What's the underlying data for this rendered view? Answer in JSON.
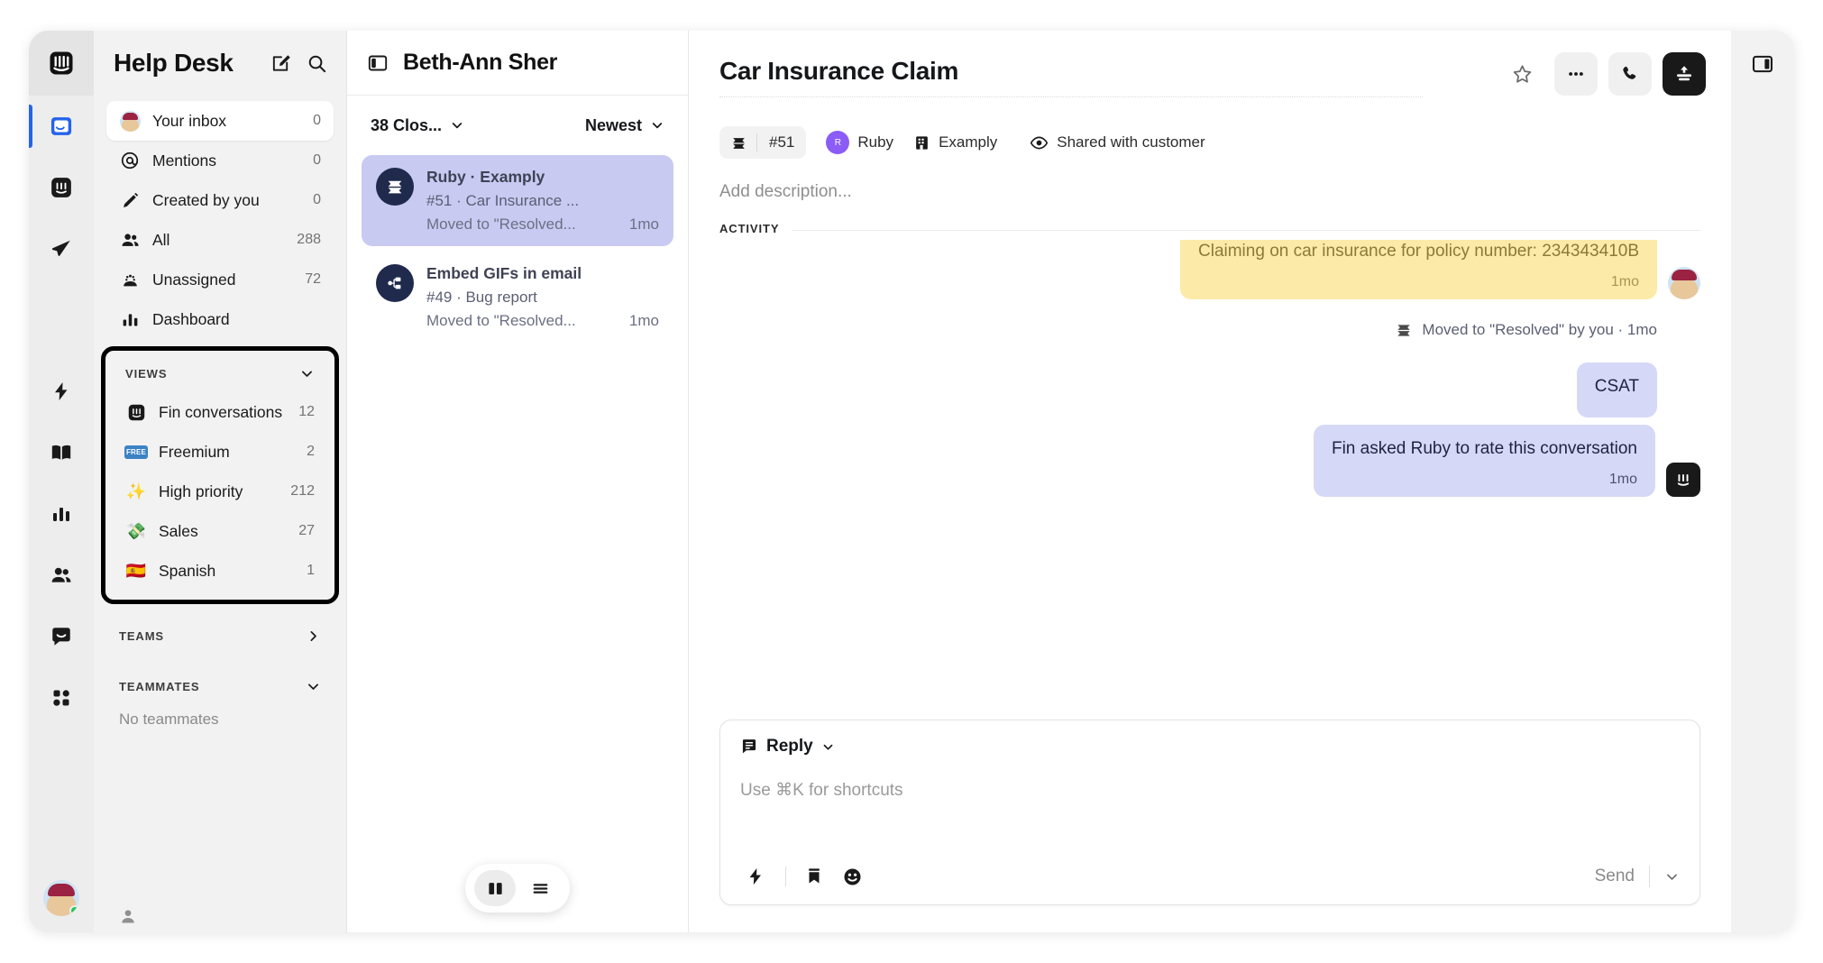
{
  "rail": {
    "logo_icon": "intercom-logo-icon",
    "items": [
      {
        "name": "inbox",
        "icon": "inbox-icon",
        "active": true
      },
      {
        "name": "fin",
        "icon": "fin-ai-icon",
        "active": false
      },
      {
        "name": "outbound",
        "icon": "paper-plane-icon",
        "active": false
      },
      {
        "name": "automation",
        "icon": "lightning-icon",
        "active": false
      },
      {
        "name": "knowledge",
        "icon": "book-icon",
        "active": false
      },
      {
        "name": "reports",
        "icon": "bar-chart-icon",
        "active": false
      },
      {
        "name": "contacts",
        "icon": "people-icon",
        "active": false
      },
      {
        "name": "messenger",
        "icon": "messenger-icon",
        "active": false
      },
      {
        "name": "apps",
        "icon": "apps-grid-icon",
        "active": false
      }
    ],
    "avatar_name": "user-avatar",
    "status": "online"
  },
  "sidebar": {
    "title": "Help Desk",
    "compose_icon": "compose-icon",
    "search_icon": "search-icon",
    "inbox_items": [
      {
        "label": "Your inbox",
        "count": "0",
        "icon": "user-avatar",
        "selected": true
      },
      {
        "label": "Mentions",
        "count": "0",
        "icon": "at-icon",
        "selected": false
      },
      {
        "label": "Created by you",
        "count": "0",
        "icon": "pencil-icon",
        "selected": false
      },
      {
        "label": "All",
        "count": "288",
        "icon": "people-icon",
        "selected": false
      },
      {
        "label": "Unassigned",
        "count": "72",
        "icon": "unassigned-icon",
        "selected": false
      },
      {
        "label": "Dashboard",
        "count": "",
        "icon": "bar-chart-icon",
        "selected": false
      }
    ],
    "views": {
      "title": "VIEWS",
      "chevron": "chevron-down-icon",
      "items": [
        {
          "label": "Fin conversations",
          "count": "12",
          "icon": "fin-ai-icon",
          "emoji": ""
        },
        {
          "label": "Freemium",
          "count": "2",
          "icon": "free-badge-icon",
          "emoji": ""
        },
        {
          "label": "High priority",
          "count": "212",
          "icon": "sparkles-icon",
          "emoji": "✨"
        },
        {
          "label": "Sales",
          "count": "27",
          "icon": "money-icon",
          "emoji": "💸"
        },
        {
          "label": "Spanish",
          "count": "1",
          "icon": "spain-flag-icon",
          "emoji": "🇪🇸"
        }
      ]
    },
    "teams": {
      "title": "TEAMS",
      "chevron": "chevron-right-icon"
    },
    "teammates": {
      "title": "TEAMMATES",
      "chevron": "chevron-down-icon",
      "empty_text": "No teammates"
    }
  },
  "list": {
    "panel_icon": "panel-toggle-icon",
    "title": "Beth-Ann Sher",
    "filter_status": "38 Clos...",
    "filter_sort": "Newest",
    "chevron": "chevron-down-icon",
    "conversations": [
      {
        "avatar_icon": "ticket-icon",
        "line1": "Ruby · Examply",
        "line2": "#51 · Car Insurance ...",
        "line3": "Moved to \"Resolved...",
        "time": "1mo",
        "selected": true
      },
      {
        "avatar_icon": "bug-report-icon",
        "line1": "Embed GIFs in email",
        "line2": "#49 · Bug report",
        "line3": "Moved to \"Resolved...",
        "time": "1mo",
        "selected": false
      }
    ],
    "view_toggle": [
      {
        "icon": "split-view-icon",
        "active": true
      },
      {
        "icon": "list-view-icon",
        "active": false
      }
    ]
  },
  "main": {
    "title": "Car Insurance Claim",
    "header_actions": [
      {
        "icon": "star-icon",
        "style": "plain"
      },
      {
        "icon": "more-dots-icon",
        "style": "grey"
      },
      {
        "icon": "phone-icon",
        "style": "grey"
      },
      {
        "icon": "escalate-upload-icon",
        "style": "dark"
      }
    ],
    "right_panel_icon": "right-panel-toggle-icon",
    "meta": {
      "ticket_icon": "ticket-icon",
      "ticket_id": "#51",
      "assignee_initial": "R",
      "assignee": "Ruby",
      "company_icon": "company-icon",
      "company": "Examply",
      "visibility_icon": "eye-icon",
      "visibility": "Shared with customer"
    },
    "description_placeholder": "Add description...",
    "activity_label": "ACTIVITY",
    "messages": [
      {
        "type": "customer",
        "color": "yellow",
        "text": "Claiming on car insurance for policy number: 234343410B",
        "time": "1mo",
        "avatar": "customer-avatar"
      },
      {
        "type": "system",
        "icon": "ticket-icon",
        "text": "Moved to \"Resolved\" by you · 1mo"
      },
      {
        "type": "agent",
        "color": "purple",
        "text": "CSAT",
        "time": "",
        "avatar": ""
      },
      {
        "type": "agent",
        "color": "purple",
        "text": "Fin asked Ruby to rate this conversation",
        "time": "1mo",
        "avatar": "fin-ai-icon"
      }
    ],
    "composer": {
      "mode_icon": "reply-icon",
      "mode_label": "Reply",
      "chevron": "chevron-down-icon",
      "placeholder": "Use ⌘K for shortcuts",
      "tools": [
        {
          "icon": "lightning-icon"
        },
        {
          "icon": "saved-reply-icon"
        },
        {
          "icon": "emoji-icon"
        }
      ],
      "send_label": "Send",
      "send_chevron": "chevron-down-icon"
    }
  },
  "colors": {
    "accent": "#2563eb",
    "selected_conversation": "#c8caf2",
    "customer_bubble": "#fceaa8",
    "agent_bubble": "#d6d8f7",
    "dark_button": "#191919",
    "highlight_border": "#000000"
  }
}
